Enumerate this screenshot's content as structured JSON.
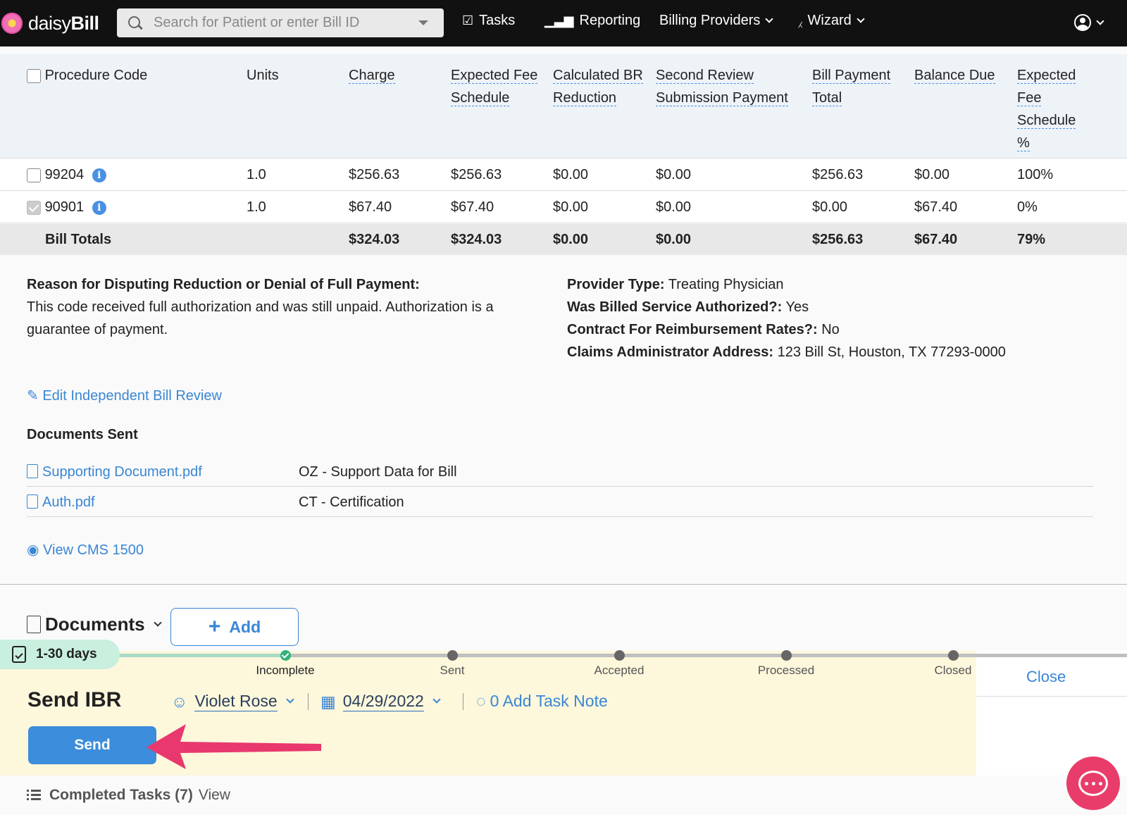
{
  "nav": {
    "brand_light": "daisy",
    "brand_bold": "Bill",
    "search_placeholder": "Search for Patient or enter Bill ID",
    "tasks": "Tasks",
    "reporting": "Reporting",
    "billing_providers": "Billing Providers",
    "wizard": "Wizard"
  },
  "table": {
    "headers": {
      "procedure_code": "Procedure Code",
      "units": "Units",
      "charge": "Charge",
      "expected_fee_1": "Expected Fee",
      "expected_fee_2": "Schedule",
      "calc_br_1": "Calculated BR",
      "calc_br_2": "Reduction",
      "second_review_1": "Second Review",
      "second_review_2": "Submission Payment",
      "bill_payment_1": "Bill Payment",
      "bill_payment_2": "Total",
      "balance_due": "Balance Due",
      "efs_pct_1": "Expected",
      "efs_pct_2": "Fee",
      "efs_pct_3": "Schedule",
      "efs_pct_4": "%"
    },
    "rows": [
      {
        "code": "99204",
        "units": "1.0",
        "charge": "$256.63",
        "expected_fee": "$256.63",
        "calc_br": "$0.00",
        "second_review": "$0.00",
        "bill_payment": "$256.63",
        "balance_due": "$0.00",
        "efs_pct": "100%",
        "checked": false
      },
      {
        "code": "90901",
        "units": "1.0",
        "charge": "$67.40",
        "expected_fee": "$67.40",
        "calc_br": "$0.00",
        "second_review": "$0.00",
        "bill_payment": "$0.00",
        "balance_due": "$67.40",
        "efs_pct": "0%",
        "checked": true
      }
    ],
    "totals": {
      "label": "Bill Totals",
      "charge": "$324.03",
      "expected_fee": "$324.03",
      "calc_br": "$0.00",
      "second_review": "$0.00",
      "bill_payment": "$256.63",
      "balance_due": "$67.40",
      "efs_pct": "79%"
    }
  },
  "details": {
    "reason_label": "Reason for Disputing Reduction or Denial of Full Payment:",
    "reason_line1": "This code received full authorization and was still unpaid. Authorization is a",
    "reason_line2": "guarantee of payment.",
    "provider_type_label": "Provider Type:",
    "provider_type": "Treating Physician",
    "authorized_label": "Was Billed Service Authorized?:",
    "authorized": "Yes",
    "contract_label": "Contract For Reimbursement Rates?:",
    "contract": "No",
    "address_label": "Claims Administrator Address:",
    "address": "123 Bill St, Houston, TX 77293-0000",
    "edit_link": "Edit Independent Bill Review",
    "documents_sent_title": "Documents Sent",
    "documents": [
      {
        "name": "Supporting Document.pdf",
        "type": "OZ - Support Data for Bill"
      },
      {
        "name": "Auth.pdf",
        "type": "CT - Certification"
      }
    ],
    "view_cms": "View CMS 1500"
  },
  "documents_section": {
    "title": "Documents",
    "add_label": "Add"
  },
  "task": {
    "days": "1-30 days",
    "steps": [
      "Incomplete",
      "Sent",
      "Accepted",
      "Processed",
      "Closed"
    ],
    "close": "Close",
    "title": "Send IBR",
    "assignee": "Violet Rose",
    "date": "04/29/2022",
    "note": "0 Add Task Note",
    "send": "Send"
  },
  "completed": {
    "label": "Completed Tasks (7)",
    "view": "View"
  },
  "colors": {
    "accent": "#3a86d4",
    "send_button": "#3c8ddb",
    "arrow": "#e8386e",
    "task_bg": "#fdf7dc",
    "badge_bg": "#c9efdf"
  }
}
